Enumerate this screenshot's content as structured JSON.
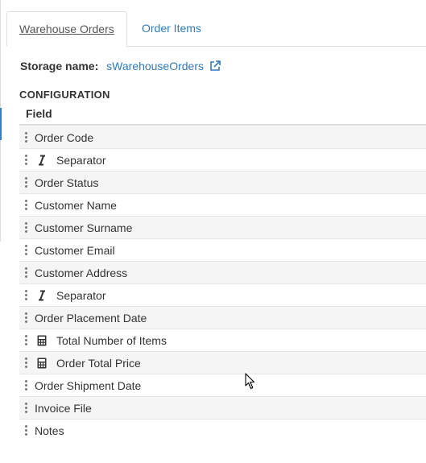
{
  "tabs": [
    {
      "label": "Warehouse Orders",
      "active": true
    },
    {
      "label": "Order Items",
      "active": false
    }
  ],
  "storage": {
    "label": "Storage name:",
    "value": "sWarehouseOrders",
    "icon": "external-link-icon"
  },
  "configuration": {
    "title": "CONFIGURATION",
    "column_header": "Field",
    "rows": [
      {
        "label": "Order Code",
        "icon": null
      },
      {
        "label": "Separator",
        "icon": "italic-icon"
      },
      {
        "label": "Order Status",
        "icon": null
      },
      {
        "label": "Customer Name",
        "icon": null
      },
      {
        "label": "Customer Surname",
        "icon": null
      },
      {
        "label": "Customer Email",
        "icon": null
      },
      {
        "label": "Customer Address",
        "icon": null
      },
      {
        "label": "Separator",
        "icon": "italic-icon"
      },
      {
        "label": "Order Placement Date",
        "icon": null
      },
      {
        "label": "Total Number of Items",
        "icon": "calculator-icon"
      },
      {
        "label": "Order Total Price",
        "icon": "calculator-icon"
      },
      {
        "label": "Order Shipment Date",
        "icon": null
      },
      {
        "label": "Invoice File",
        "icon": null
      },
      {
        "label": "Notes",
        "icon": null
      }
    ]
  },
  "colors": {
    "link": "#337ab7",
    "border": "#dddddd",
    "row_alt": "#f5f5f5"
  }
}
